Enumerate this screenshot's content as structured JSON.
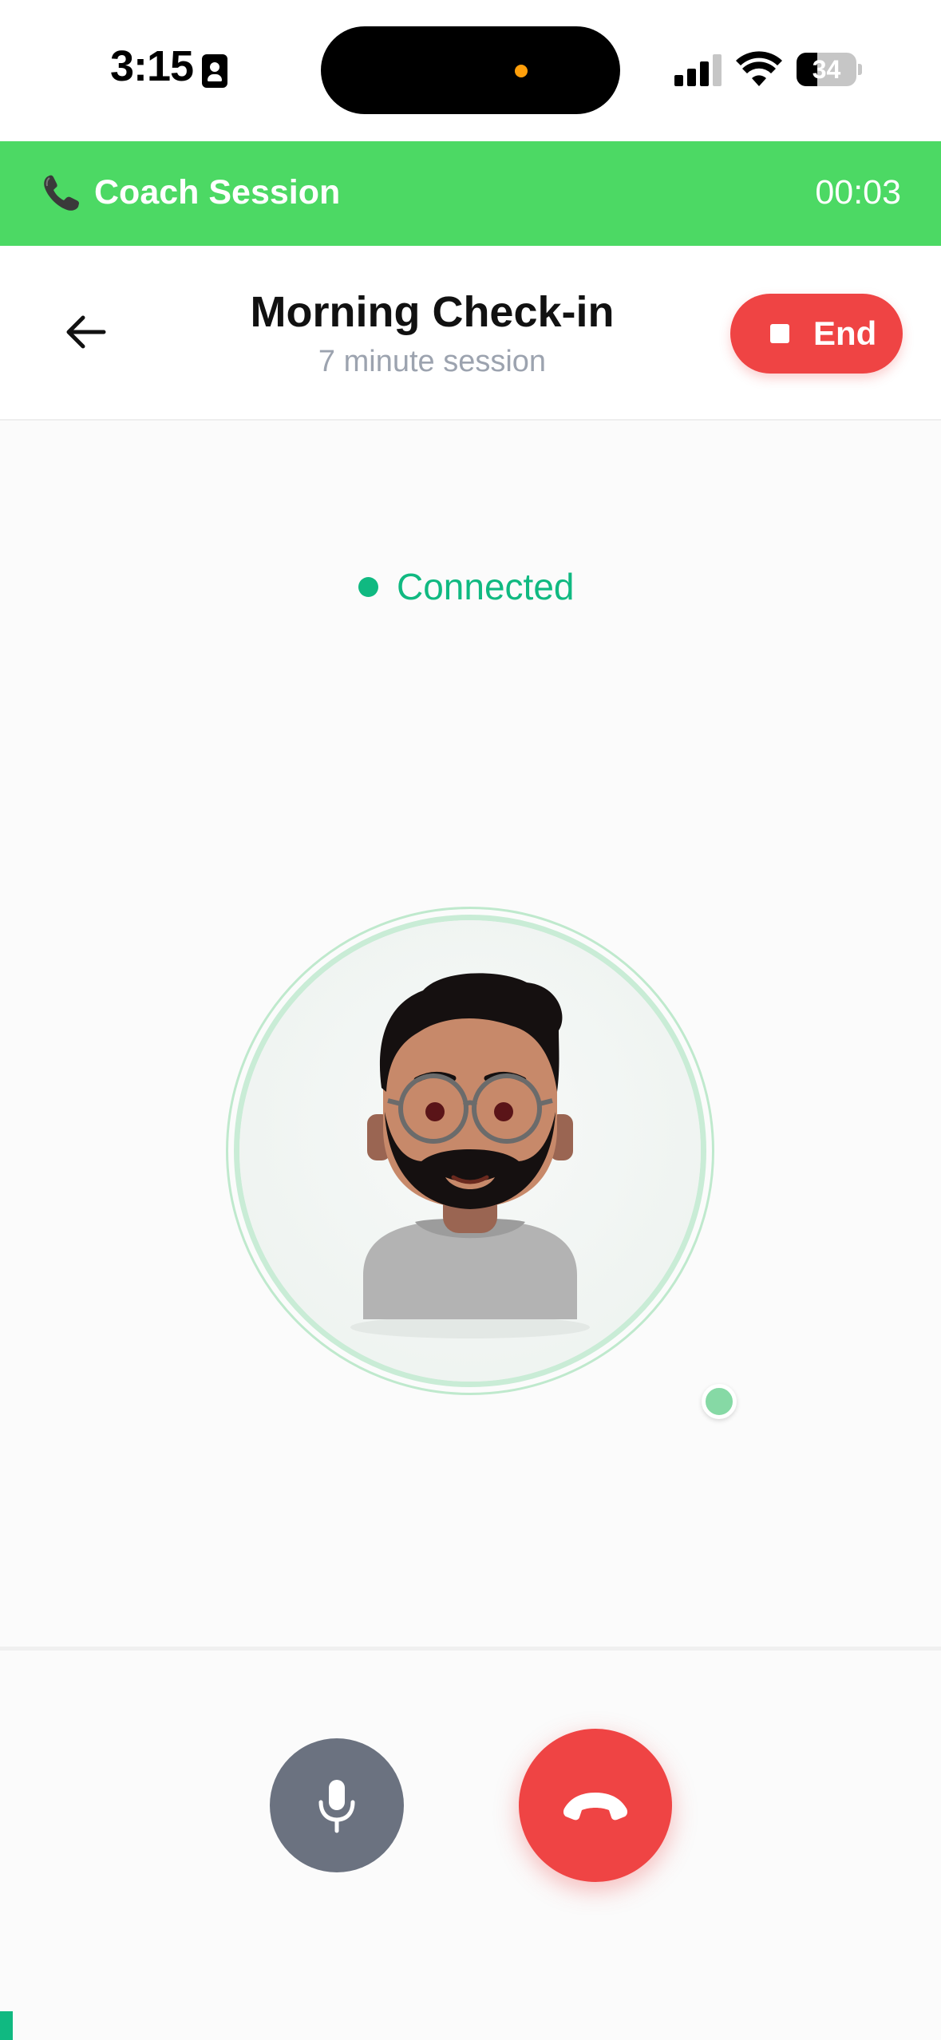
{
  "status_bar": {
    "time": "3:15",
    "battery": "34",
    "battery_level": 0.34
  },
  "banner": {
    "title": "Coach Session",
    "timer": "00:03",
    "icon": "phone-receiver-icon"
  },
  "header": {
    "title": "Morning Check-in",
    "subtitle": "7 minute session",
    "end_label": "End"
  },
  "call": {
    "status": "Connected",
    "status_color": "#10b981"
  },
  "colors": {
    "banner": "#4cd964",
    "end": "#ef4444",
    "mic": "#6b7280",
    "hangup": "#ef4444"
  }
}
